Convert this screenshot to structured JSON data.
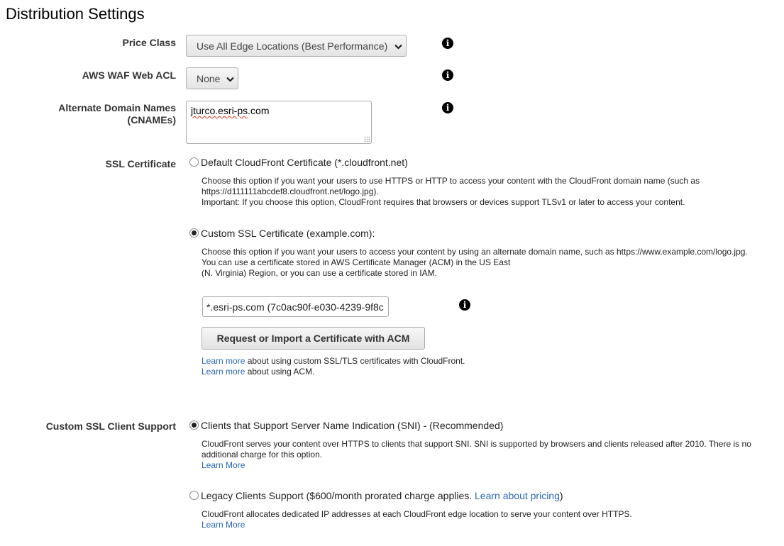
{
  "page": {
    "title": "Distribution Settings"
  },
  "icons": {
    "info": "info-icon",
    "chevron": "chevron-down-icon",
    "grip": "resize-grip-icon"
  },
  "colors": {
    "link": "#2a68b8",
    "spellcheck": "#e0301e"
  },
  "price_class": {
    "label": "Price Class",
    "value": "Use All Edge Locations (Best Performance)",
    "info_glyph": "i"
  },
  "waf": {
    "label": "AWS WAF Web ACL",
    "value": "None",
    "info_glyph": "i"
  },
  "cnames": {
    "label_line1": "Alternate Domain Names",
    "label_line2": "(CNAMEs)",
    "value_part1": "jturco.esri-ps",
    "value_part2": ".com",
    "info_glyph": "i"
  },
  "ssl": {
    "label": "SSL Certificate",
    "default_option": {
      "label": "Default CloudFront Certificate (*.cloudfront.net)",
      "selected": false,
      "desc_line1": "Choose this option if you want your users to use HTTPS or HTTP to access your content with the CloudFront domain name (such as",
      "desc_line2": "https://d111111abcdef8.cloudfront.net/logo.jpg).",
      "desc_line3": "Important: If you choose this option, CloudFront requires that browsers or devices support TLSv1 or later to access your content."
    },
    "custom_option": {
      "label": "Custom SSL Certificate (example.com):",
      "selected": true,
      "desc_line1": "Choose this option if you want your users to access your content by using an alternate domain name, such as https://www.example.com/logo.jpg.",
      "desc_line2": "You can use a certificate stored in AWS Certificate Manager (ACM) in the US East",
      "desc_line3": "(N. Virginia) Region, or you can use a certificate stored in IAM."
    },
    "certificate_value": "*.esri-ps.com (7c0ac90f-e030-4239-9f8c",
    "info_glyph": "i",
    "acm_button": "Request or Import a Certificate with ACM",
    "learn_more_1_link": "Learn more",
    "learn_more_1_text": " about using custom SSL/TLS certificates with CloudFront.",
    "learn_more_2_link": "Learn more",
    "learn_more_2_text": " about using ACM."
  },
  "client_support": {
    "label": "Custom SSL Client Support",
    "sni_option": {
      "label": "Clients that Support Server Name Indication (SNI) - (Recommended)",
      "selected": true,
      "desc_line1": "CloudFront serves your content over HTTPS to clients that support SNI. SNI is supported by browsers and clients released after 2010. There is no",
      "desc_line2": "additional charge for this option.",
      "learn_more": "Learn More"
    },
    "legacy_option": {
      "label_prefix": "Legacy Clients Support ($600/month prorated charge applies. ",
      "pricing_link": "Learn about pricing",
      "label_suffix": ")",
      "selected": false,
      "desc_line1": "CloudFront allocates dedicated IP addresses at each CloudFront edge location to serve your content over HTTPS.",
      "learn_more": "Learn More"
    }
  }
}
